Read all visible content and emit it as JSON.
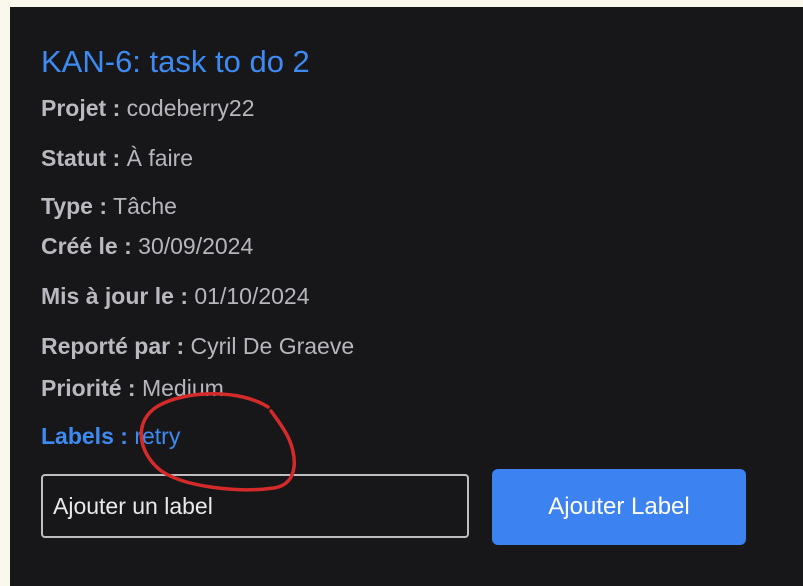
{
  "issue": {
    "title": "KAN-6: task to do 2",
    "fields": [
      {
        "key": "Projet :",
        "value": "codeberry22"
      },
      {
        "key": "Statut :",
        "value": "À faire"
      },
      {
        "key": "Type :",
        "value": "Tâche"
      },
      {
        "key": "Créé le :",
        "value": "30/09/2024"
      },
      {
        "key": "Mis à jour le :",
        "value": "01/10/2024"
      },
      {
        "key": "Reporté par :",
        "value": "Cyril De Graeve"
      },
      {
        "key": "Priorité :",
        "value": "Medium"
      },
      {
        "key": "Labels :",
        "value": "retry"
      }
    ]
  },
  "label_form": {
    "input_placeholder": "Ajouter un label",
    "input_value": "",
    "button_label": "Ajouter Label"
  },
  "colors": {
    "background": "#17171a",
    "accent": "#3d8bf2",
    "button": "#3c82f0",
    "annotation": "#d42a2a"
  }
}
